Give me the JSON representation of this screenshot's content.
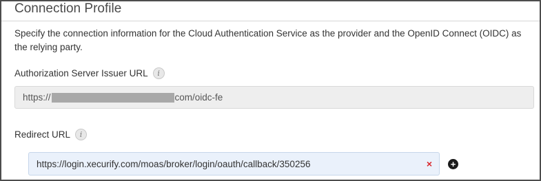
{
  "section": {
    "title": "Connection Profile",
    "description": "Specify the connection information for the Cloud Authentication Service as the provider and the OpenID Connect (OIDC) as the relying party."
  },
  "issuer": {
    "label": "Authorization Server Issuer URL",
    "value_prefix": "https://",
    "value_suffix": "com/oidc-fe"
  },
  "redirect": {
    "label": "Redirect URL",
    "value": "https://login.xecurify.com/moas/broker/login/oauth/callback/350256",
    "clear_glyph": "×",
    "add_glyph": "+"
  },
  "icons": {
    "info": "info-icon",
    "clear": "clear-icon",
    "add": "add-circle-icon"
  },
  "colors": {
    "clear": "#d9262b",
    "active_field": "#eaf1fb",
    "readonly_field": "#eeeeee"
  }
}
